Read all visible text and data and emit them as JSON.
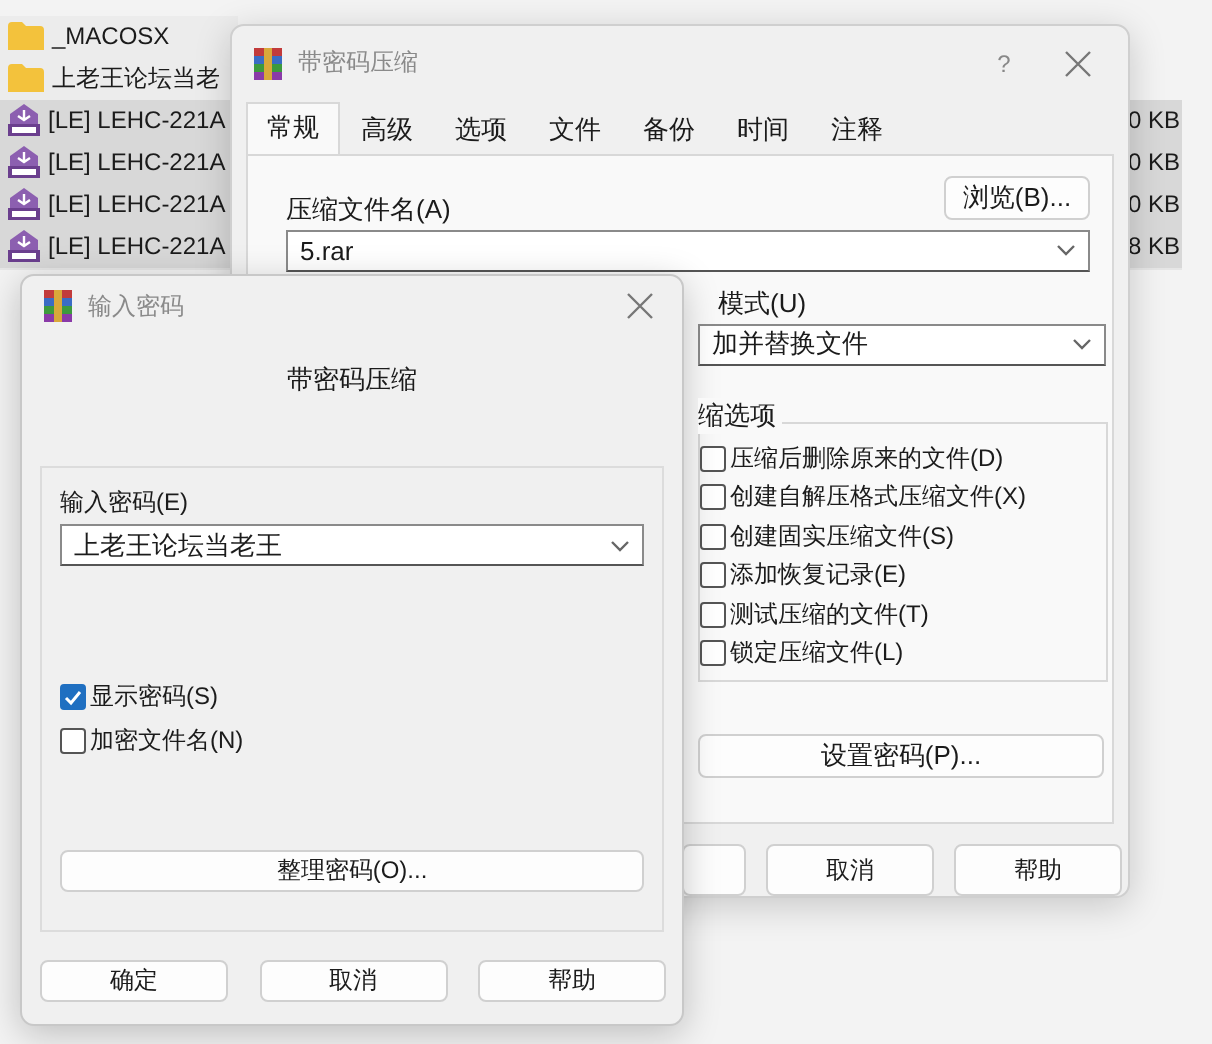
{
  "file_list": {
    "rows": [
      {
        "kind": "folder",
        "name": "_MACOSX",
        "selected": false
      },
      {
        "kind": "folder",
        "name": "上老王论坛当老",
        "selected": false
      },
      {
        "kind": "rar",
        "name": "[LE] LEHC-221A",
        "size": "0 KB",
        "selected": true
      },
      {
        "kind": "rar",
        "name": "[LE] LEHC-221A",
        "size": "0 KB",
        "selected": true
      },
      {
        "kind": "rar",
        "name": "[LE] LEHC-221A",
        "size": "0 KB",
        "selected": true
      },
      {
        "kind": "rar",
        "name": "[LE] LEHC-221A",
        "size": "8 KB",
        "selected": true
      }
    ]
  },
  "archive_dialog": {
    "title": "带密码压缩",
    "help_glyph": "?",
    "tabs": [
      {
        "label": "常规",
        "selected": true
      },
      {
        "label": "高级",
        "selected": false
      },
      {
        "label": "选项",
        "selected": false
      },
      {
        "label": "文件",
        "selected": false
      },
      {
        "label": "备份",
        "selected": false
      },
      {
        "label": "时间",
        "selected": false
      },
      {
        "label": "注释",
        "selected": false
      }
    ],
    "archive_name_label": "压缩文件名(A)",
    "browse_button": "浏览(B)...",
    "archive_name": "5.rar",
    "update_mode_label": "模式(U)",
    "update_mode": "加并替换文件",
    "options_group": "缩选项",
    "options": [
      {
        "label": "压缩后删除原来的文件(D)",
        "checked": false
      },
      {
        "label": "创建自解压格式压缩文件(X)",
        "checked": false
      },
      {
        "label": "创建固实压缩文件(S)",
        "checked": false
      },
      {
        "label": "添加恢复记录(E)",
        "checked": false
      },
      {
        "label": "测试压缩的文件(T)",
        "checked": false
      },
      {
        "label": "锁定压缩文件(L)",
        "checked": false
      }
    ],
    "set_password_button": "设置密码(P)...",
    "buttons": [
      "取消",
      "帮助"
    ]
  },
  "password_dialog": {
    "title": "输入密码",
    "heading": "带密码压缩",
    "password_label": "输入密码(E)",
    "password": "上老王论坛当老王",
    "options": [
      {
        "label": "显示密码(S)",
        "checked": true
      },
      {
        "label": "加密文件名(N)",
        "checked": false
      }
    ],
    "organize_button": "整理密码(O)...",
    "buttons": [
      "确定",
      "取消",
      "帮助"
    ]
  }
}
